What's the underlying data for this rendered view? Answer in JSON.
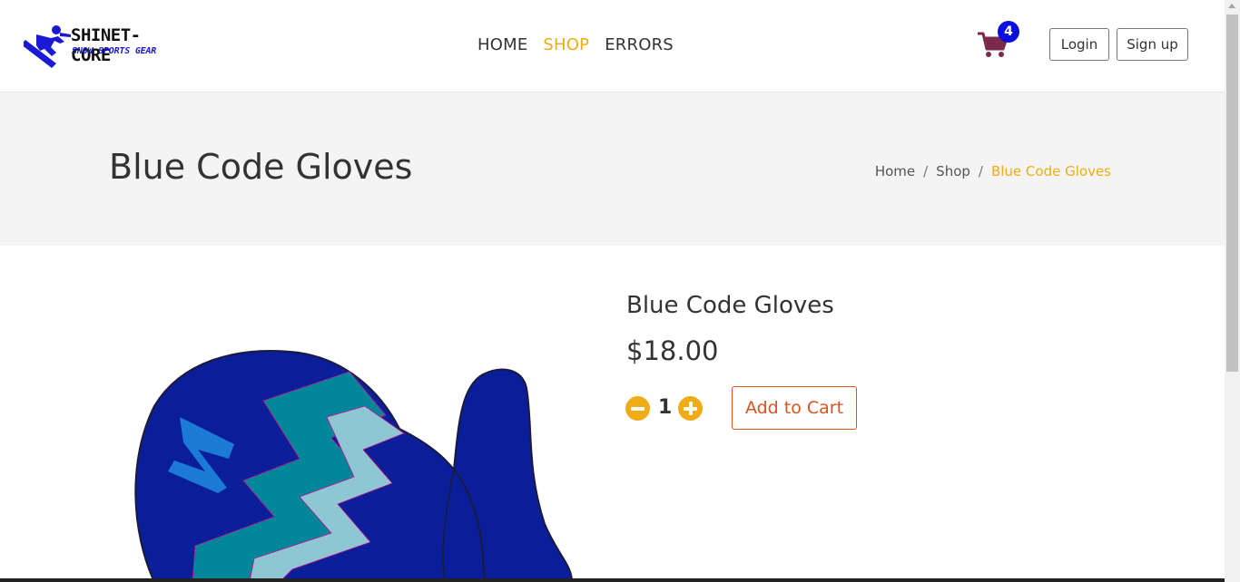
{
  "header": {
    "logo_text_top": "SHINET-CORE",
    "logo_text_bottom": "SNOW SPORTS GEAR",
    "nav": [
      {
        "label": "HOME",
        "active": false
      },
      {
        "label": "SHOP",
        "active": true
      },
      {
        "label": "ERRORS",
        "active": false
      }
    ],
    "cart_icon": "shopping-cart-icon",
    "cart_count": "4",
    "login_label": "Login",
    "signup_label": "Sign up"
  },
  "page": {
    "title": "Blue Code Gloves",
    "breadcrumb": [
      "Home",
      "Shop",
      "Blue Code Gloves"
    ]
  },
  "product": {
    "name": "Blue Code Gloves",
    "price": "$18.00",
    "quantity": "1",
    "add_to_cart_label": "Add to Cart",
    "image_icon": "mitten-product-image"
  },
  "colors": {
    "accent": "#f0ac17",
    "cart_button": "#d9531e",
    "badge": "#0b0ee0",
    "cart_icon": "#7a2a4a",
    "mitten": "#0a1e9a",
    "zigzag_dark": "#00869a",
    "zigzag_light": "#8fc6d4"
  }
}
